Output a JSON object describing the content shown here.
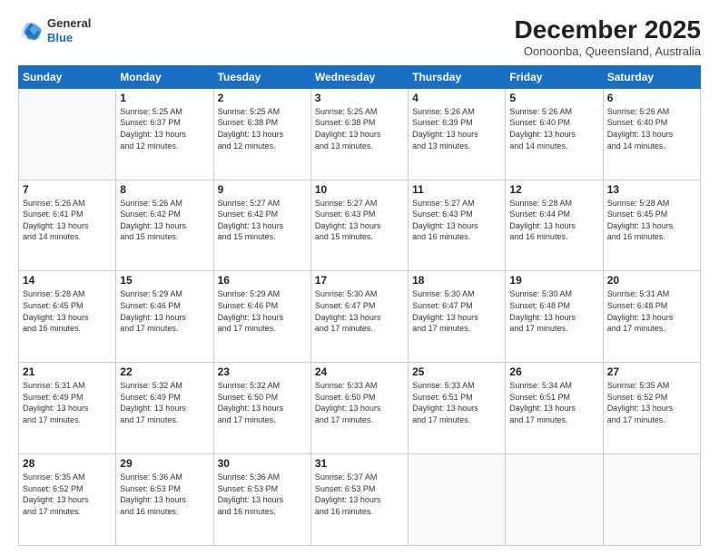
{
  "logo": {
    "line1": "General",
    "line2": "Blue"
  },
  "header": {
    "title": "December 2025",
    "subtitle": "Oonoonba, Queensland, Australia"
  },
  "weekdays": [
    "Sunday",
    "Monday",
    "Tuesday",
    "Wednesday",
    "Thursday",
    "Friday",
    "Saturday"
  ],
  "weeks": [
    [
      {
        "day": "",
        "text": ""
      },
      {
        "day": "1",
        "text": "Sunrise: 5:25 AM\nSunset: 6:37 PM\nDaylight: 13 hours\nand 12 minutes."
      },
      {
        "day": "2",
        "text": "Sunrise: 5:25 AM\nSunset: 6:38 PM\nDaylight: 13 hours\nand 12 minutes."
      },
      {
        "day": "3",
        "text": "Sunrise: 5:25 AM\nSunset: 6:38 PM\nDaylight: 13 hours\nand 13 minutes."
      },
      {
        "day": "4",
        "text": "Sunrise: 5:26 AM\nSunset: 6:39 PM\nDaylight: 13 hours\nand 13 minutes."
      },
      {
        "day": "5",
        "text": "Sunrise: 5:26 AM\nSunset: 6:40 PM\nDaylight: 13 hours\nand 14 minutes."
      },
      {
        "day": "6",
        "text": "Sunrise: 5:26 AM\nSunset: 6:40 PM\nDaylight: 13 hours\nand 14 minutes."
      }
    ],
    [
      {
        "day": "7",
        "text": "Sunrise: 5:26 AM\nSunset: 6:41 PM\nDaylight: 13 hours\nand 14 minutes."
      },
      {
        "day": "8",
        "text": "Sunrise: 5:26 AM\nSunset: 6:42 PM\nDaylight: 13 hours\nand 15 minutes."
      },
      {
        "day": "9",
        "text": "Sunrise: 5:27 AM\nSunset: 6:42 PM\nDaylight: 13 hours\nand 15 minutes."
      },
      {
        "day": "10",
        "text": "Sunrise: 5:27 AM\nSunset: 6:43 PM\nDaylight: 13 hours\nand 15 minutes."
      },
      {
        "day": "11",
        "text": "Sunrise: 5:27 AM\nSunset: 6:43 PM\nDaylight: 13 hours\nand 16 minutes."
      },
      {
        "day": "12",
        "text": "Sunrise: 5:28 AM\nSunset: 6:44 PM\nDaylight: 13 hours\nand 16 minutes."
      },
      {
        "day": "13",
        "text": "Sunrise: 5:28 AM\nSunset: 6:45 PM\nDaylight: 13 hours\nand 16 minutes."
      }
    ],
    [
      {
        "day": "14",
        "text": "Sunrise: 5:28 AM\nSunset: 6:45 PM\nDaylight: 13 hours\nand 16 minutes."
      },
      {
        "day": "15",
        "text": "Sunrise: 5:29 AM\nSunset: 6:46 PM\nDaylight: 13 hours\nand 17 minutes."
      },
      {
        "day": "16",
        "text": "Sunrise: 5:29 AM\nSunset: 6:46 PM\nDaylight: 13 hours\nand 17 minutes."
      },
      {
        "day": "17",
        "text": "Sunrise: 5:30 AM\nSunset: 6:47 PM\nDaylight: 13 hours\nand 17 minutes."
      },
      {
        "day": "18",
        "text": "Sunrise: 5:30 AM\nSunset: 6:47 PM\nDaylight: 13 hours\nand 17 minutes."
      },
      {
        "day": "19",
        "text": "Sunrise: 5:30 AM\nSunset: 6:48 PM\nDaylight: 13 hours\nand 17 minutes."
      },
      {
        "day": "20",
        "text": "Sunrise: 5:31 AM\nSunset: 6:48 PM\nDaylight: 13 hours\nand 17 minutes."
      }
    ],
    [
      {
        "day": "21",
        "text": "Sunrise: 5:31 AM\nSunset: 6:49 PM\nDaylight: 13 hours\nand 17 minutes."
      },
      {
        "day": "22",
        "text": "Sunrise: 5:32 AM\nSunset: 6:49 PM\nDaylight: 13 hours\nand 17 minutes."
      },
      {
        "day": "23",
        "text": "Sunrise: 5:32 AM\nSunset: 6:50 PM\nDaylight: 13 hours\nand 17 minutes."
      },
      {
        "day": "24",
        "text": "Sunrise: 5:33 AM\nSunset: 6:50 PM\nDaylight: 13 hours\nand 17 minutes."
      },
      {
        "day": "25",
        "text": "Sunrise: 5:33 AM\nSunset: 6:51 PM\nDaylight: 13 hours\nand 17 minutes."
      },
      {
        "day": "26",
        "text": "Sunrise: 5:34 AM\nSunset: 6:51 PM\nDaylight: 13 hours\nand 17 minutes."
      },
      {
        "day": "27",
        "text": "Sunrise: 5:35 AM\nSunset: 6:52 PM\nDaylight: 13 hours\nand 17 minutes."
      }
    ],
    [
      {
        "day": "28",
        "text": "Sunrise: 5:35 AM\nSunset: 6:52 PM\nDaylight: 13 hours\nand 17 minutes."
      },
      {
        "day": "29",
        "text": "Sunrise: 5:36 AM\nSunset: 6:53 PM\nDaylight: 13 hours\nand 16 minutes."
      },
      {
        "day": "30",
        "text": "Sunrise: 5:36 AM\nSunset: 6:53 PM\nDaylight: 13 hours\nand 16 minutes."
      },
      {
        "day": "31",
        "text": "Sunrise: 5:37 AM\nSunset: 6:53 PM\nDaylight: 13 hours\nand 16 minutes."
      },
      {
        "day": "",
        "text": ""
      },
      {
        "day": "",
        "text": ""
      },
      {
        "day": "",
        "text": ""
      }
    ]
  ]
}
